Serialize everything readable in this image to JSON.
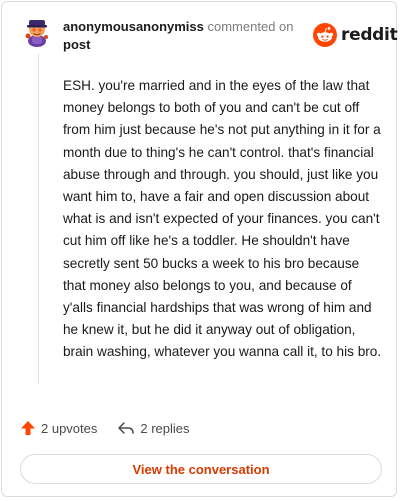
{
  "header": {
    "username": "anonymousanonymiss",
    "action_text": "commented on",
    "post_link": "post",
    "logo_text": "reddit"
  },
  "comment": {
    "body": "ESH. you're married and in the eyes of the law that money belongs to both of you and can't be cut off from him just because he's not put anything in it for a month due to thing's he can't control. that's financial abuse through and through. you should, just like you want him to, have a fair and open discussion about what is and isn't expected of your finances. you can't cut him off like he's a toddler. He shouldn't have secretly sent 50 bucks a week to his bro because that money also belongs to you, and because of y'alls financial hardships that was wrong of him and he knew it, but he did it anyway out of obligation, brain washing, whatever you wanna call it, to his bro."
  },
  "actions": {
    "upvotes": "2 upvotes",
    "replies": "2 replies"
  },
  "cta": {
    "view_conversation": "View the conversation"
  },
  "colors": {
    "brand_orange": "#ff4500",
    "link_orange": "#d93a00",
    "avatar_purple": "#6b3fa0"
  },
  "icons": {
    "avatar": "snoo-avatar-icon",
    "logo": "reddit-snoo-icon",
    "upvote": "upvote-arrow-icon",
    "reply": "reply-arrow-icon"
  }
}
